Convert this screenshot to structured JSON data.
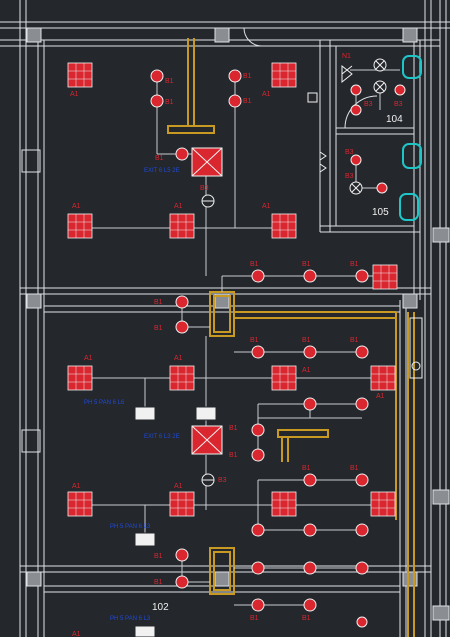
{
  "room_numbers": {
    "r104": "104",
    "r105": "105",
    "r102": "102"
  },
  "fixture_labels": {
    "a1": "A1",
    "b1": "B1",
    "b3": "B3",
    "n1": "N1"
  },
  "panel_notes": {
    "note1": "PH 5 PAN 6 L6",
    "note2": "PH 5 PAN 6 L3",
    "note3": "PH 5 PAN 6 L3"
  },
  "emergency_notes": {
    "e1": "EXIT 6 L5 2E",
    "e2": "EXIT 6 L3 2E"
  },
  "colors": {
    "background": "#24272c",
    "wall": "#dfe3e8",
    "wire": "#c8ccd2",
    "fixture": "#d9262f",
    "duct": "#c99a22",
    "annotation": "#1f4bd8",
    "plumbing": "#1fc6c8"
  }
}
